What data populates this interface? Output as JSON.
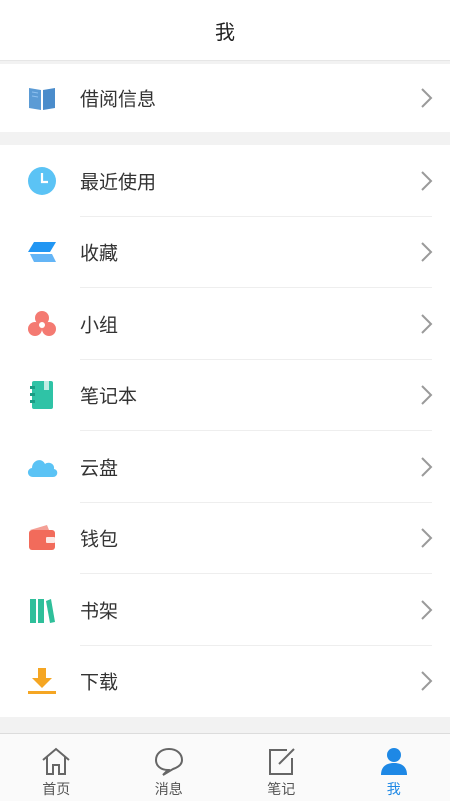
{
  "header": {
    "title": "我"
  },
  "groups": {
    "borrow": {
      "label": "借阅信息"
    },
    "items": [
      {
        "label": "最近使用"
      },
      {
        "label": "收藏"
      },
      {
        "label": "小组"
      },
      {
        "label": "笔记本"
      },
      {
        "label": "云盘"
      },
      {
        "label": "钱包"
      },
      {
        "label": "书架"
      },
      {
        "label": "下载"
      }
    ]
  },
  "tabbar": {
    "tabs": [
      {
        "label": "首页"
      },
      {
        "label": "消息"
      },
      {
        "label": "笔记"
      },
      {
        "label": "我"
      }
    ],
    "active": "我"
  },
  "colors": {
    "accent": "#1e88e5",
    "book": "#5b9bd5",
    "clock": "#5bc3f5",
    "favorites": "#2196f3",
    "group": "#f47a72",
    "notebook": "#2fc3a6",
    "cloud": "#5bc3f5",
    "wallet": "#f26b5b",
    "bookshelf": "#2fbf9a",
    "download": "#f5a623"
  }
}
